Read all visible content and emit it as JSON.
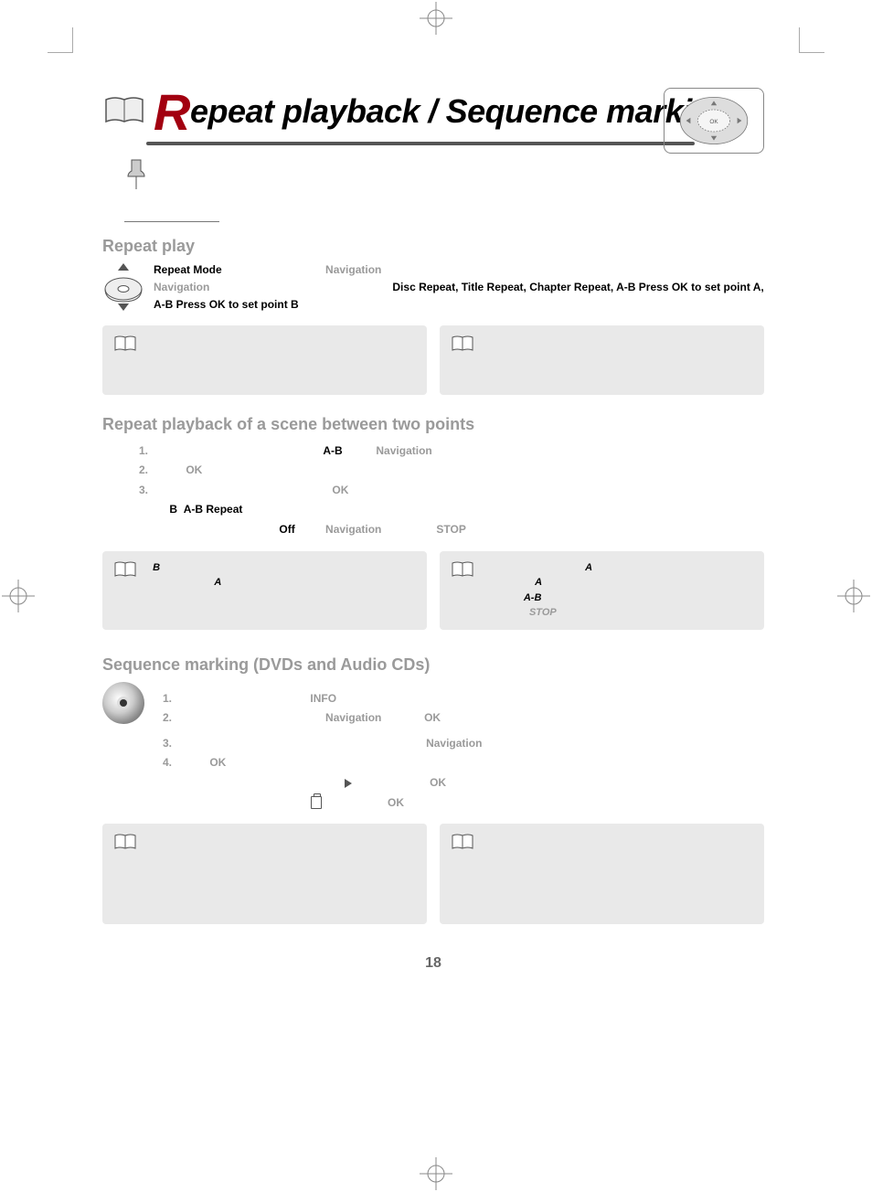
{
  "page_number": "18",
  "main_title": "Repeat playback / Sequence marking",
  "sections": {
    "repeat_play": {
      "heading": "Repeat play",
      "body_prefix": "",
      "bold1": "Repeat Mode",
      "grey1": "Navigation",
      "grey2": "Navigation",
      "bold_list": "Disc Repeat, Title Repeat, Chapter Repeat, A-B Press OK to set point A, A-B Press OK to set point B"
    },
    "ab": {
      "heading": "Repeat playback of a scene between two points",
      "l1_ab": "A-B",
      "l1_nav": "Navigation",
      "l2_ok": "OK",
      "l3_ok": "OK",
      "l3_b": "B",
      "l3_abrep": "A-B Repeat",
      "off": "Off",
      "nav2": "Navigation",
      "stop": "STOP",
      "note_left_b": "B",
      "note_left_a": "A",
      "note_right_a1": "A",
      "note_right_a2": "A",
      "note_right_ab": "A-B",
      "note_right_stop": "STOP"
    },
    "seq": {
      "heading": "Sequence marking (DVDs and Audio CDs)",
      "l1_info": "INFO",
      "l2_nav": "Navigation",
      "l2_ok": "OK",
      "l3_nav": "Navigation",
      "l4_ok": "OK",
      "l4_ok2": "OK",
      "l4_ok3": "OK"
    }
  }
}
